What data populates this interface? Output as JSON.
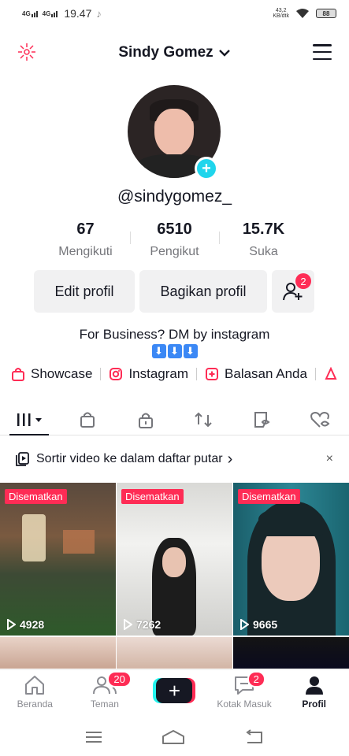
{
  "status_bar": {
    "signal1": "4G",
    "signal2": "4G",
    "time": "19.47",
    "net_speed_value": "43,2",
    "net_speed_unit": "KB/dtk",
    "battery": "88"
  },
  "header": {
    "profile_name": "Sindy Gomez"
  },
  "profile": {
    "username": "@sindygomez_",
    "stats": [
      {
        "value": "67",
        "label": "Mengikuti"
      },
      {
        "value": "6510",
        "label": "Pengikut"
      },
      {
        "value": "15.7K",
        "label": "Suka"
      }
    ],
    "edit_label": "Edit profil",
    "share_label": "Bagikan profil",
    "add_friend_badge": "2",
    "bio_line": "For Business? DM by instagram",
    "bio_arrows": [
      "⬇",
      "⬇",
      "⬇"
    ]
  },
  "links": [
    {
      "label": "Showcase",
      "icon": "shopping-bag-icon"
    },
    {
      "label": "Instagram",
      "icon": "instagram-icon"
    },
    {
      "label": "Balasan Anda",
      "icon": "reply-icon"
    }
  ],
  "tabs": [
    "videos-grid-icon",
    "shop-icon",
    "private-lock-icon",
    "repost-icon",
    "favorites-icon",
    "liked-icon"
  ],
  "sort_bar": {
    "label": "Sortir video ke dalam daftar putar",
    "chevron": "›",
    "close": "×"
  },
  "videos": [
    {
      "pinned": "Disematkan",
      "views": "4928"
    },
    {
      "pinned": "Disematkan",
      "views": "7262"
    },
    {
      "pinned": "Disematkan",
      "views": "9665"
    }
  ],
  "bottom_nav": [
    {
      "label": "Beranda",
      "icon": "home-icon"
    },
    {
      "label": "Teman",
      "icon": "friends-icon",
      "badge": "20"
    },
    {
      "label": "",
      "icon": "create-icon"
    },
    {
      "label": "Kotak Masuk",
      "icon": "inbox-icon",
      "badge": "2"
    },
    {
      "label": "Profil",
      "icon": "profile-icon"
    }
  ],
  "colors": {
    "accent": "#fe2c55",
    "cyan": "#20d5ec",
    "text": "#161823",
    "muted": "#75767b"
  }
}
